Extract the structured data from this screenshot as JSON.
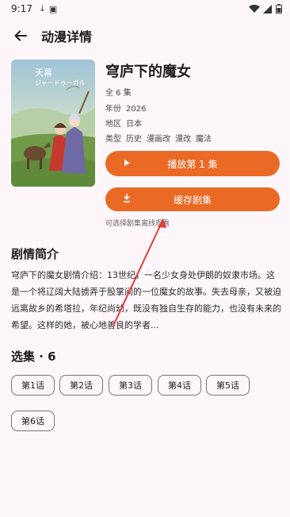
{
  "status_bar": {
    "time": "9:17"
  },
  "app_bar": {
    "title": "动漫详情"
  },
  "anime": {
    "title": "穹庐下的魔女",
    "episodes": "全 6 集",
    "year_label": "年份",
    "year": "2026",
    "region_label": "地区",
    "region": "日本",
    "genre_label": "类型",
    "genres": [
      "历史",
      "漫画改",
      "漫改",
      "魔法"
    ]
  },
  "buttons": {
    "play_label": "播放第 1 集",
    "cache_label": "缓存剧集",
    "cache_hint": "可选择剧集离线观看"
  },
  "synopsis": {
    "title": "剧情简介",
    "text": "穹庐下的魔女剧情介绍：13世纪，一名少女身处伊朗的奴隶市场。这是一个将辽阔大陆掳弄于股掌间的一位魔女的故事。失去母亲，又被迫远离故乡的希塔拉，年纪尚幼，既没有独自生存的能力，也没有未来的希望。这样的她，被心地善良的学者..."
  },
  "episodes_section": {
    "title": "选集 · 6",
    "items": [
      "第1话",
      "第2话",
      "第3话",
      "第4话",
      "第5话",
      "第6话"
    ]
  },
  "colors": {
    "accent": "#ea6a25",
    "annotation_red": "#e53935",
    "background": "#fdf7fb"
  }
}
